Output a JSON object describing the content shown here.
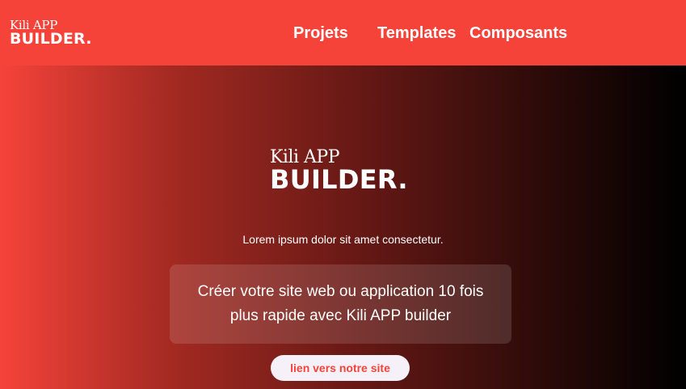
{
  "header": {
    "logo_line1": "Kili APP",
    "logo_line2": "BUILDER.",
    "nav": [
      "Projets",
      "Templates",
      "Composants"
    ]
  },
  "hero": {
    "logo_line1": "Kili APP",
    "logo_line2": "BUILDER.",
    "tagline": "Lorem ipsum dolor sit amet consectetur.",
    "card_text": "Créer votre site web ou application 10 fois plus rapide avec Kili APP builder",
    "cta_label": "lien vers notre site"
  },
  "colors": {
    "brand": "#f5433a",
    "button_bg": "#f6f1f8"
  }
}
